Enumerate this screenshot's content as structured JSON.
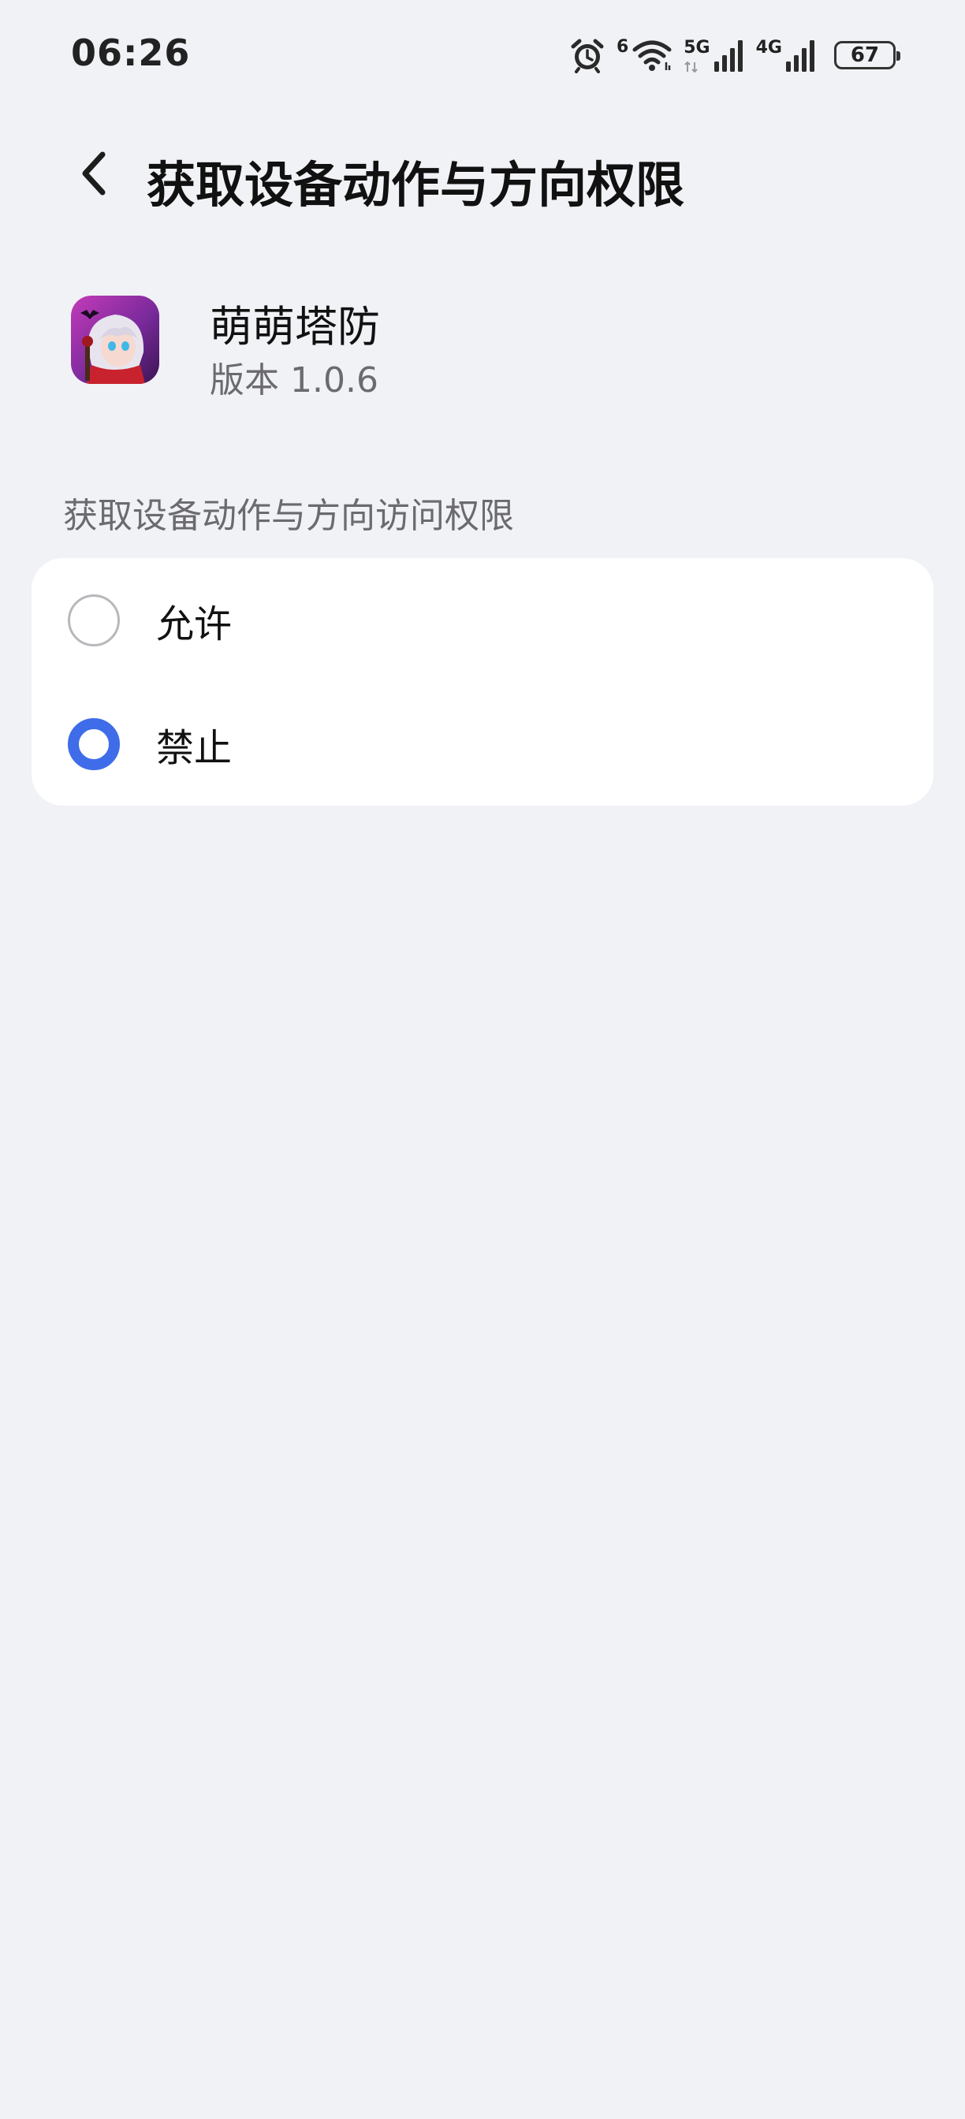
{
  "status_bar": {
    "time": "06:26",
    "wifi_badge": "6",
    "net1_label": "5G",
    "net2_label": "4G",
    "battery_level": "67",
    "icons": [
      "alarm-icon",
      "wifi-icon",
      "signal-icon",
      "battery-icon"
    ]
  },
  "header": {
    "title": "获取设备动作与方向权限"
  },
  "app": {
    "name": "萌萌塔防",
    "version": "版本 1.0.6"
  },
  "section": {
    "label": "获取设备动作与方向访问权限",
    "options": [
      {
        "label": "允许",
        "selected": false
      },
      {
        "label": "禁止",
        "selected": true
      }
    ]
  },
  "colors": {
    "accent": "#3f6ce8",
    "background": "#f1f2f6",
    "card": "#ffffff"
  }
}
